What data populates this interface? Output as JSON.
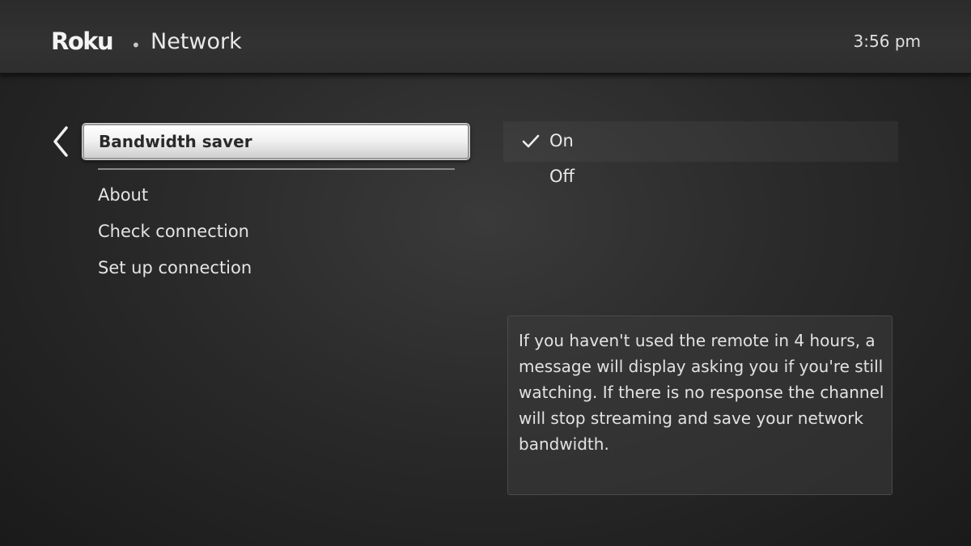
{
  "header": {
    "logo": "Roku",
    "separator": "•",
    "title": "Network",
    "time": "3:56 pm"
  },
  "menu": {
    "selected": "Bandwidth saver",
    "items": [
      "About",
      "Check connection",
      "Set up connection"
    ]
  },
  "options": {
    "items": [
      {
        "label": "On",
        "checked": true
      },
      {
        "label": "Off",
        "checked": false
      }
    ]
  },
  "info": {
    "text": "If you haven't used the remote in 4 hours, a message will display asking you if you're still watching. If there is no response the channel will stop streaming and save your network bandwidth."
  },
  "icons": {
    "back": "chevron-left-icon",
    "check": "check-icon"
  },
  "colors": {
    "background": "#2a2a2a",
    "header": "#303030",
    "selection": "#f2f2f2",
    "text": "#e6e6e6"
  }
}
